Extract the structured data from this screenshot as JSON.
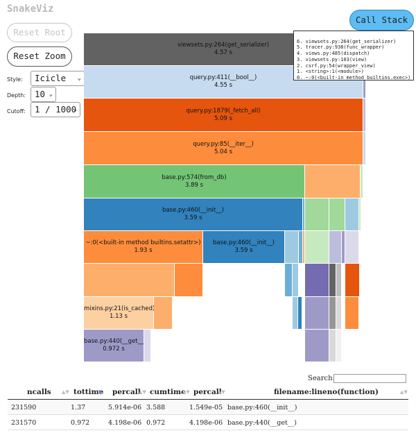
{
  "app": {
    "title": "SnakeViz"
  },
  "buttons": {
    "reset_root": "Reset Root",
    "reset_zoom": "Reset Zoom",
    "call_stack": "Call Stack"
  },
  "controls": {
    "style_label": "Style:",
    "style_value": "Icicle",
    "depth_label": "Depth:",
    "depth_value": "10",
    "cutoff_label": "Cutoff:",
    "cutoff_value": "1 / 1000"
  },
  "call_stack": [
    "6. viewsets.py:264(get_serializer)",
    "5. tracer.py:938(func_wrapper)",
    "4. views.py:485(dispatch)",
    "3. viewsets.py:103(view)",
    "2. csrf.py:54(wrapper_view)",
    "1. <string>:1(<module>)",
    "0. ~:0(<built-in method builtins.exec>)"
  ],
  "colors": {
    "gray_dark": "#626262",
    "blue_light": "#c6dbef",
    "orange_dark": "#e6550d",
    "orange": "#fd8d3c",
    "green": "#74c476",
    "blue": "#3182bd",
    "blue2": "#6baed6",
    "orange_light": "#fdae6b",
    "peach": "#fdd0a2",
    "green_light": "#a1d99b",
    "green_pale": "#c7e9c0",
    "purple": "#756bb1",
    "purple_light": "#9e9ac8",
    "purple_pale": "#bcbddc",
    "blue_pale": "#9ecae1"
  },
  "flame_labels": [
    {
      "name": "viewsets.py:264(get_serializer)",
      "time": "4.57 s"
    },
    {
      "name": "query.py:411(__bool__)",
      "time": "4.55 s"
    },
    {
      "name": "query.py:1879(_fetch_all)",
      "time": "5.09 s"
    },
    {
      "name": "query.py:85(__iter__)",
      "time": "5.04 s"
    },
    {
      "name": "base.py:574(from_db)",
      "time": "3.89 s"
    },
    {
      "name": "base.py:460(__init__)",
      "time": "3.59 s"
    },
    {
      "name": "~:0(<built-in method builtins.setattr>)",
      "time": "1.93 s"
    },
    {
      "name": "base.py:460(__init__)",
      "time": "3.59 s"
    },
    {
      "name": "mixins.py:21(is_cached)",
      "time": "1.13 s"
    },
    {
      "name": "base.py:440(__get__)",
      "time": "0.972 s"
    }
  ],
  "search": {
    "label": "Search:",
    "value": ""
  },
  "table": {
    "headers": [
      "ncalls",
      "tottime",
      "percall",
      "cumtime",
      "percall",
      "filename:lineno(function)"
    ],
    "rows": [
      [
        "231590",
        "1.37",
        "5.914e-06",
        "3.588",
        "1.549e-05",
        "base.py:460(__init__)"
      ],
      [
        "231570",
        "0.972",
        "4.198e-06",
        "0.972",
        "4.198e-06",
        "base.py:440(__get__)"
      ]
    ]
  }
}
